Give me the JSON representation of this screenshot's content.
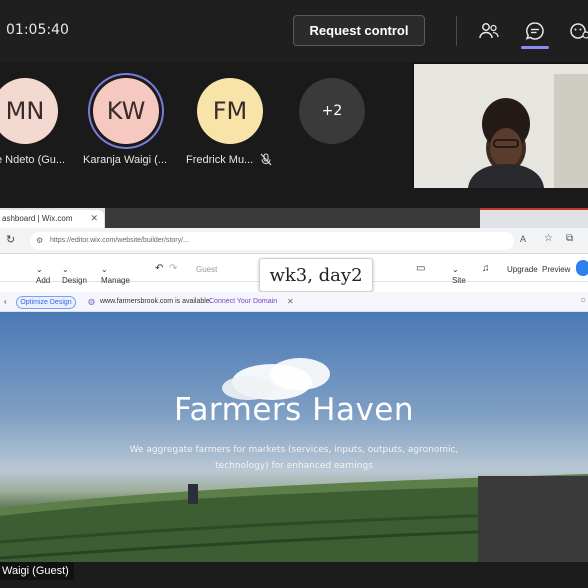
{
  "meeting": {
    "timer": "01:05:40",
    "request_control_label": "Request control"
  },
  "participants": [
    {
      "initials": "MN",
      "name": "e Ndeto (Gu...",
      "color": "#f3d9cf"
    },
    {
      "initials": "KW",
      "name": "Karanja Waigi (...",
      "color": "#f6c9c0"
    },
    {
      "initials": "FM",
      "name": "Fredrick Mu...",
      "color": "#f8e3a8"
    },
    {
      "initials": "+2",
      "name": "",
      "color": "#3a3a3a"
    }
  ],
  "browser": {
    "tab_title": "ashboard | Wix.com",
    "url": "https://editor.wix.com/website/builder/story/...",
    "editor_menu": {
      "add": "Add",
      "design": "Design",
      "manage": "Manage",
      "guest": "Guest",
      "site": "Site",
      "upgrade": "Upgrade",
      "preview": "Preview"
    },
    "domain_bar": {
      "optimize_label": "Optimize Design",
      "domain_text": "www.farmersbrook.com is available.",
      "connect_label": "Connect Your Domain"
    }
  },
  "overlay_label": "wk3, day2",
  "site": {
    "title": "Farmers Haven",
    "subtitle": "We aggregate farmers for markets (services, inputs, outputs, agronomic, technology) for enhanced earnings"
  },
  "presenter_label": "Waigi (Guest)",
  "colors": {
    "accent": "#8b8cf3",
    "link": "#3368e0",
    "topbar": "#1f1f1f"
  }
}
